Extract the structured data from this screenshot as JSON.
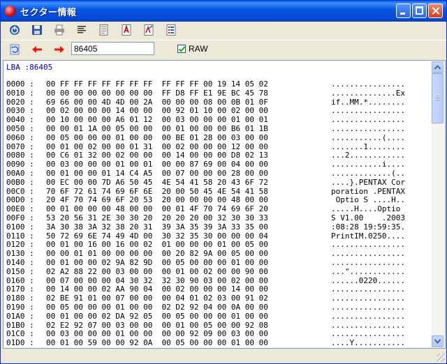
{
  "window": {
    "title": "セクター情報"
  },
  "toolbar": {
    "icons": [
      "power-icon",
      "save-icon",
      "print-icon",
      "list-text-icon",
      "document-icon",
      "pdf-icon",
      "pdf-export-icon",
      "spreadsheet-icon"
    ]
  },
  "nav": {
    "lba_value": "86405",
    "raw_label": "RAW",
    "raw_checked": true
  },
  "sector": {
    "lba_label": "LBA :86405",
    "rows": [
      {
        "off": "0000 :",
        "hex": "00 FF FF FF FF FF FF FF  FF FF FF 00 19 14 05 02",
        "asc": "................"
      },
      {
        "off": "0010 :",
        "hex": "00 00 00 00 00 00 00 00  FF D8 FF E1 9E BC 45 78",
        "asc": "..............Ex"
      },
      {
        "off": "0020 :",
        "hex": "69 66 00 00 4D 4D 00 2A  00 00 00 08 00 0B 01 0F",
        "asc": "if..MM.*........"
      },
      {
        "off": "0030 :",
        "hex": "00 02 00 00 00 14 00 00  00 92 01 10 00 02 00 00",
        "asc": "................"
      },
      {
        "off": "0040 :",
        "hex": "00 10 00 00 00 A6 01 12  00 03 00 00 00 01 00 01",
        "asc": "................"
      },
      {
        "off": "0050 :",
        "hex": "00 00 01 1A 00 05 00 00  00 01 00 00 00 B6 01 1B",
        "asc": "................"
      },
      {
        "off": "0060 :",
        "hex": "00 05 00 00 00 01 00 00  00 BE 01 28 00 03 00 00",
        "asc": "...........(...."
      },
      {
        "off": "0070 :",
        "hex": "00 01 00 02 00 00 01 31  00 02 00 00 00 12 00 00",
        "asc": ".......1........"
      },
      {
        "off": "0080 :",
        "hex": "00 C6 01 32 00 02 00 00  00 14 00 00 00 D8 02 13",
        "asc": "...2............"
      },
      {
        "off": "0090 :",
        "hex": "00 03 00 00 00 01 00 01  00 00 87 69 00 04 00 00",
        "asc": "...........i...."
      },
      {
        "off": "00A0 :",
        "hex": "00 01 00 00 01 14 C4 A5  00 07 00 00 00 28 00 00",
        "asc": ".............(.."
      },
      {
        "off": "00B0 :",
        "hex": "00 EC 00 00 7D A6 50 45  4E 54 41 58 20 43 6F 72",
        "asc": "....}.PENTAX Cor"
      },
      {
        "off": "00C0 :",
        "hex": "70 6F 72 61 74 69 6F 6E  20 00 50 45 4E 54 41 58",
        "asc": "poration .PENTAX"
      },
      {
        "off": "00D0 :",
        "hex": "20 4F 70 74 69 6F 20 53  20 00 00 00 00 48 00 00",
        "asc": " Optio S ....H.."
      },
      {
        "off": "00E0 :",
        "hex": "00 01 00 00 00 48 00 00  00 01 4F 70 74 69 6F 20",
        "asc": ".....H....Optio "
      },
      {
        "off": "00F0 :",
        "hex": "53 20 56 31 2E 30 30 20  20 20 20 00 32 30 30 33",
        "asc": "S V1.00    .2003"
      },
      {
        "off": "0100 :",
        "hex": "3A 30 38 3A 32 38 20 31  39 3A 35 39 3A 33 35 00",
        "asc": ":08:28 19:59:35."
      },
      {
        "off": "0110 :",
        "hex": "50 72 69 6E 74 49 4D 00  30 32 35 30 00 00 00 04",
        "asc": "PrintIM.0250...."
      },
      {
        "off": "0120 :",
        "hex": "00 01 00 16 00 16 00 02  01 00 00 00 01 00 05 00",
        "asc": "................"
      },
      {
        "off": "0130 :",
        "hex": "00 00 01 01 00 00 00 00  00 20 82 9A 00 05 00 00",
        "asc": "................"
      },
      {
        "off": "0140 :",
        "hex": "00 01 00 00 02 9A 82 9D  00 05 00 00 00 01 00 00",
        "asc": "................"
      },
      {
        "off": "0150 :",
        "hex": "02 A2 88 22 00 03 00 00  00 01 00 02 00 00 90 00",
        "asc": "...\"............"
      },
      {
        "off": "0160 :",
        "hex": "00 07 00 00 00 04 30 32  32 30 90 03 00 02 00 00",
        "asc": "......0220......"
      },
      {
        "off": "0170 :",
        "hex": "00 14 00 00 02 AA 90 04  00 02 00 00 00 14 00 00",
        "asc": "................"
      },
      {
        "off": "0180 :",
        "hex": "02 BE 91 01 00 07 00 00  00 04 01 02 03 00 91 02",
        "asc": "................"
      },
      {
        "off": "0190 :",
        "hex": "00 05 00 00 00 01 00 00  02 D2 92 04 00 0A 00 00",
        "asc": "................"
      },
      {
        "off": "01A0 :",
        "hex": "00 01 00 00 02 DA 92 05  00 05 00 00 00 01 00 00",
        "asc": "................"
      },
      {
        "off": "01B0 :",
        "hex": "02 E2 92 07 00 03 00 00  00 01 00 05 00 00 92 08",
        "asc": "................"
      },
      {
        "off": "01C0 :",
        "hex": "00 03 00 00 00 01 00 00  00 00 92 09 00 03 00 00",
        "asc": "................"
      },
      {
        "off": "01D0 :",
        "hex": "00 01 00 59 00 00 92 0A  00 05 00 00 00 01 00 00",
        "asc": "....Y..........."
      }
    ]
  }
}
